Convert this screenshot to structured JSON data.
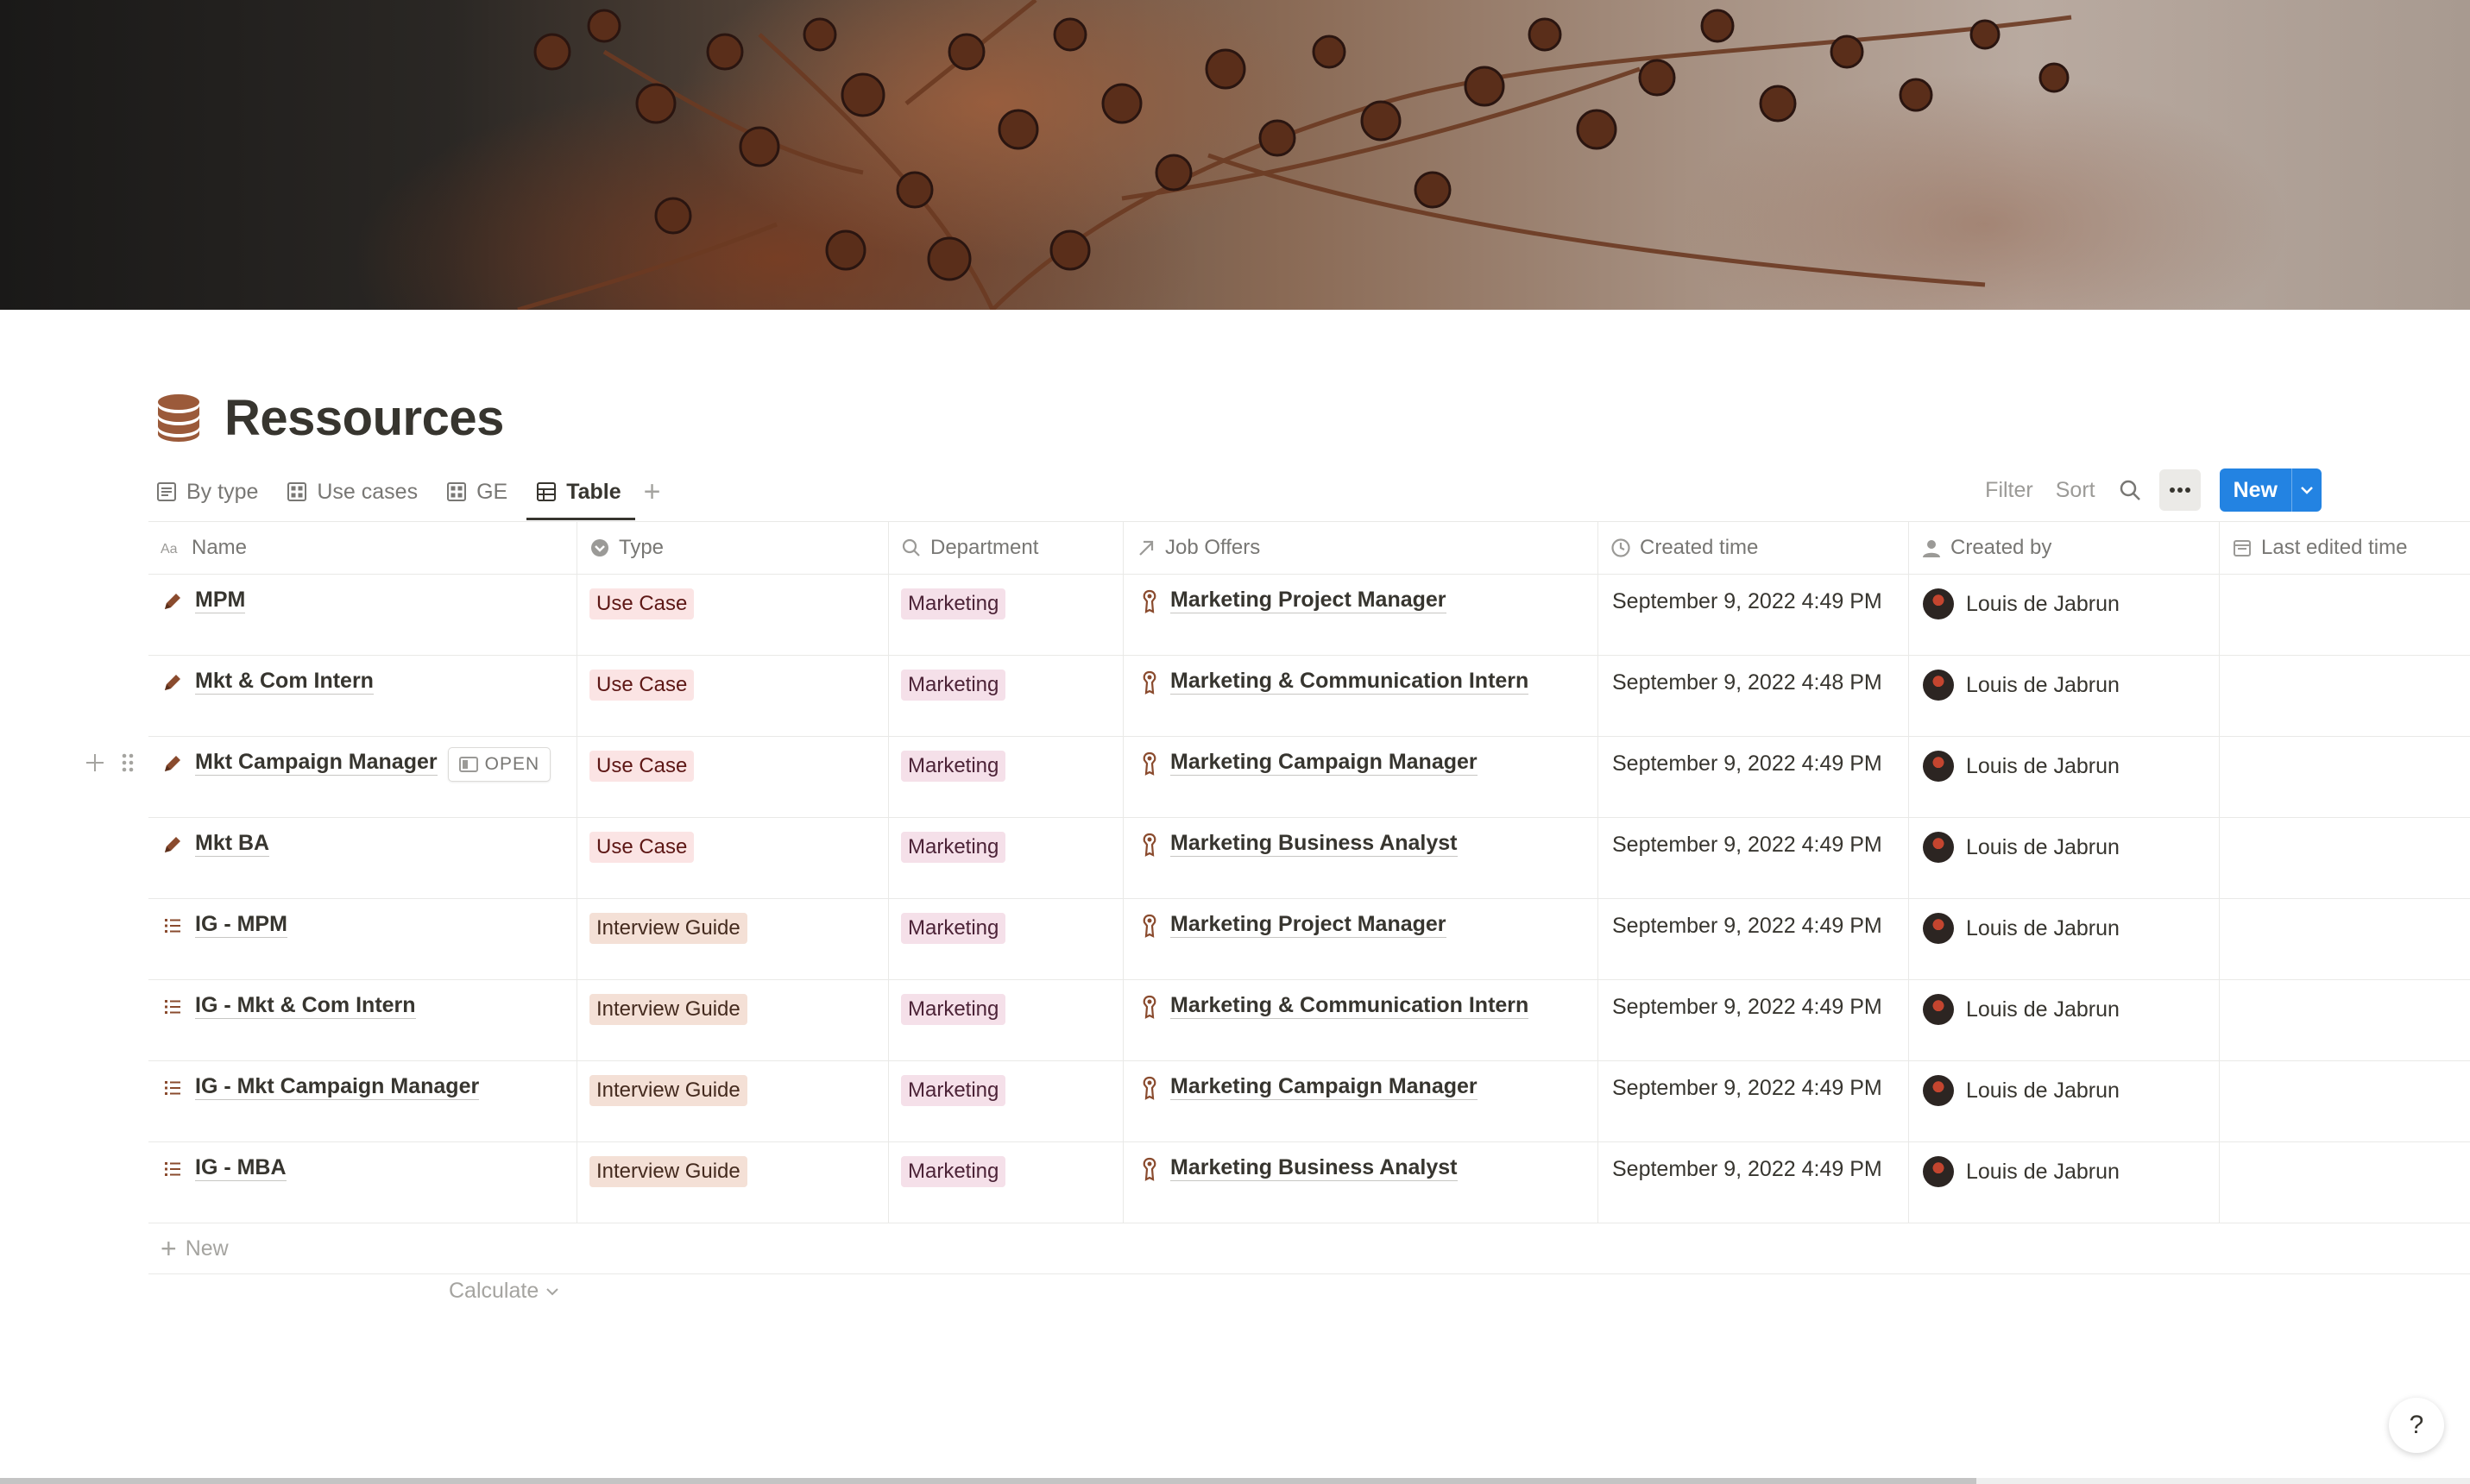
{
  "page": {
    "title": "Ressources",
    "icon": "database-icon"
  },
  "views": [
    {
      "label": "By type",
      "icon": "list-view-icon",
      "active": false
    },
    {
      "label": "Use cases",
      "icon": "gallery-view-icon",
      "active": false
    },
    {
      "label": "GE",
      "icon": "gallery-view-icon",
      "active": false
    },
    {
      "label": "Table",
      "icon": "table-view-icon",
      "active": true
    }
  ],
  "toolbar": {
    "filter": "Filter",
    "sort": "Sort",
    "new": "New"
  },
  "columns": {
    "name": "Name",
    "type": "Type",
    "department": "Department",
    "job_offers": "Job Offers",
    "created_time": "Created time",
    "created_by": "Created by",
    "last_edited": "Last edited time"
  },
  "rows": [
    {
      "name": "MPM",
      "icon": "pencil-icon",
      "type": "Use Case",
      "department": "Marketing",
      "job_offer": "Marketing Project Manager",
      "created_time": "September 9, 2022 4:49 PM",
      "created_by": "Louis de Jabrun"
    },
    {
      "name": "Mkt & Com Intern",
      "icon": "pencil-icon",
      "type": "Use Case",
      "department": "Marketing",
      "job_offer": "Marketing & Communication Intern",
      "created_time": "September 9, 2022 4:48 PM",
      "created_by": "Louis de Jabrun"
    },
    {
      "name": "Mkt Campaign Manager",
      "icon": "pencil-icon",
      "type": "Use Case",
      "department": "Marketing",
      "job_offer": "Marketing Campaign Manager",
      "created_time": "September 9, 2022 4:49 PM",
      "created_by": "Louis de Jabrun",
      "open_label": "OPEN"
    },
    {
      "name": "Mkt BA",
      "icon": "pencil-icon",
      "type": "Use Case",
      "department": "Marketing",
      "job_offer": "Marketing Business Analyst",
      "created_time": "September 9, 2022 4:49 PM",
      "created_by": "Louis de Jabrun"
    },
    {
      "name": "IG - MPM",
      "icon": "list-icon",
      "type": "Interview Guide",
      "department": "Marketing",
      "job_offer": "Marketing Project Manager",
      "created_time": "September 9, 2022 4:49 PM",
      "created_by": "Louis de Jabrun"
    },
    {
      "name": "IG - Mkt & Com Intern",
      "icon": "list-icon",
      "type": "Interview Guide",
      "department": "Marketing",
      "job_offer": "Marketing & Communication Intern",
      "created_time": "September 9, 2022 4:49 PM",
      "created_by": "Louis de Jabrun"
    },
    {
      "name": "IG - Mkt Campaign Manager",
      "icon": "list-icon",
      "type": "Interview Guide",
      "department": "Marketing",
      "job_offer": "Marketing Campaign Manager",
      "created_time": "September 9, 2022 4:49 PM",
      "created_by": "Louis de Jabrun"
    },
    {
      "name": "IG - MBA",
      "icon": "list-icon",
      "type": "Interview Guide",
      "department": "Marketing",
      "job_offer": "Marketing Business Analyst",
      "created_time": "September 9, 2022 4:49 PM",
      "created_by": "Louis de Jabrun"
    }
  ],
  "footer": {
    "new_row": "New",
    "calculate": "Calculate"
  },
  "help": "?",
  "colors": {
    "accent": "#2383e2",
    "use_case_bg": "#fbe4e4",
    "guide_bg": "#f4e0d6",
    "marketing_bg": "#f5e0e9"
  }
}
